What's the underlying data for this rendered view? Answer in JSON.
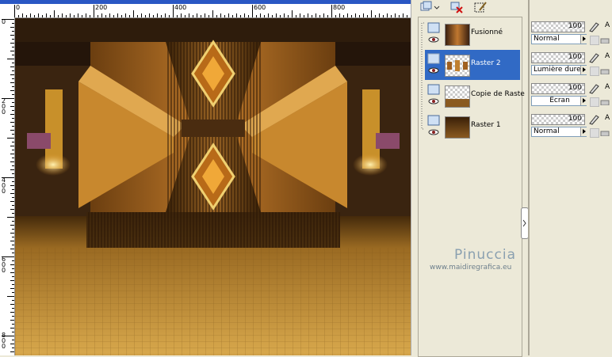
{
  "ruler": {
    "top_labels": [
      "0",
      "200",
      "400",
      "600",
      "800"
    ],
    "left_labels": [
      "0",
      "2\n0\n0",
      "4\n0\n0",
      "6\n0\n0",
      "8\n0\n0"
    ]
  },
  "layers": [
    {
      "name": "Fusionné",
      "selected": false
    },
    {
      "name": "Raster 2",
      "selected": true
    },
    {
      "name": "Copie de Raste",
      "selected": false
    },
    {
      "name": "Raster 1",
      "selected": false
    }
  ],
  "properties": [
    {
      "opacity": "100",
      "blend": "Normal",
      "letter": "A"
    },
    {
      "opacity": "100",
      "blend": "Lumière dure",
      "letter": "A"
    },
    {
      "opacity": "100",
      "blend": "Écran",
      "letter": "A"
    },
    {
      "opacity": "100",
      "blend": "Normal",
      "letter": "A"
    }
  ],
  "watermark": {
    "name": "Pinuccia",
    "url": "www.maidiregrafica.eu"
  },
  "colors": {
    "selection": "#316ac5",
    "titlebar": "#2a57c4"
  }
}
